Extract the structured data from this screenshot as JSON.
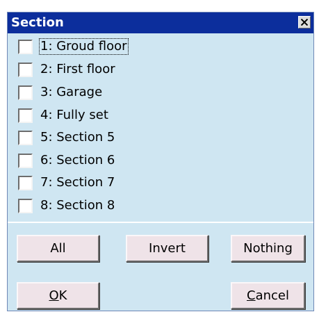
{
  "window": {
    "title": "Section",
    "close_glyph": "close-icon"
  },
  "sections": [
    {
      "label": "1: Groud floor",
      "checked": false,
      "focused": true
    },
    {
      "label": "2: First floor",
      "checked": false
    },
    {
      "label": "3: Garage",
      "checked": false
    },
    {
      "label": "4: Fully set",
      "checked": false
    },
    {
      "label": "5: Section 5",
      "checked": false
    },
    {
      "label": "6: Section 6",
      "checked": false
    },
    {
      "label": "7: Section 7",
      "checked": false
    },
    {
      "label": "8: Section 8",
      "checked": false
    }
  ],
  "buttons": {
    "all": "All",
    "invert": "Invert",
    "nothing": "Nothing",
    "ok_mnemonic": "O",
    "ok_rest": "K",
    "cancel_mnemonic": "C",
    "cancel_rest": "ancel"
  },
  "colors": {
    "titlebar": "#0c2e9c",
    "dialog_background": "#cfe6f2",
    "button_face": "#efe3e8"
  }
}
